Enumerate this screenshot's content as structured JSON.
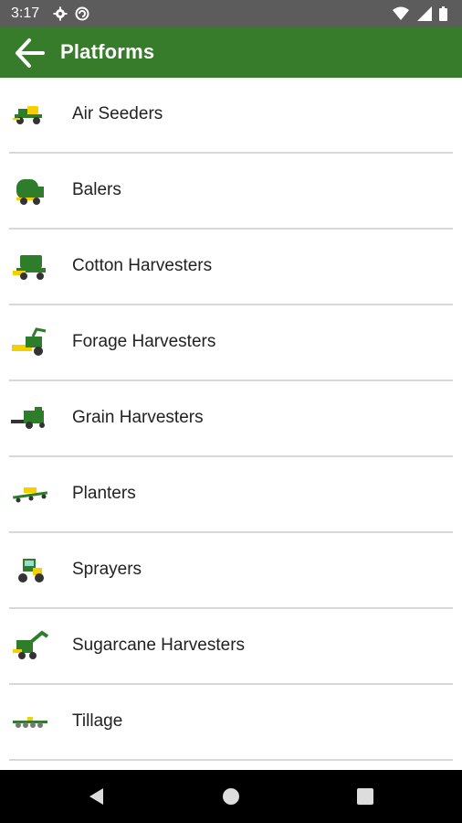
{
  "status_bar": {
    "time": "3:17",
    "left_icons": [
      "gear-icon",
      "sync-icon"
    ],
    "right_icons": [
      "wifi-icon",
      "signal-icon",
      "battery-icon"
    ]
  },
  "app_bar": {
    "title": "Platforms",
    "back_icon": "arrow-left-icon",
    "background": "#367c2b"
  },
  "platforms": [
    {
      "label": "Air Seeders",
      "icon": "air-seeder-icon"
    },
    {
      "label": "Balers",
      "icon": "baler-icon"
    },
    {
      "label": "Cotton Harvesters",
      "icon": "cotton-harvester-icon"
    },
    {
      "label": "Forage Harvesters",
      "icon": "forage-harvester-icon"
    },
    {
      "label": "Grain Harvesters",
      "icon": "grain-harvester-icon"
    },
    {
      "label": "Planters",
      "icon": "planter-icon"
    },
    {
      "label": "Sprayers",
      "icon": "sprayer-icon"
    },
    {
      "label": "Sugarcane Harvesters",
      "icon": "sugarcane-harvester-icon"
    },
    {
      "label": "Tillage",
      "icon": "tillage-icon"
    }
  ],
  "nav_bar": {
    "back": "nav-back-icon",
    "home": "nav-home-icon",
    "recents": "nav-recents-icon"
  },
  "colors": {
    "brand_green": "#367c2b",
    "machine_green": "#2e7d2a",
    "machine_yellow": "#f5d000",
    "status_bar": "#5c5c5c",
    "divider": "#d8d8d8"
  }
}
